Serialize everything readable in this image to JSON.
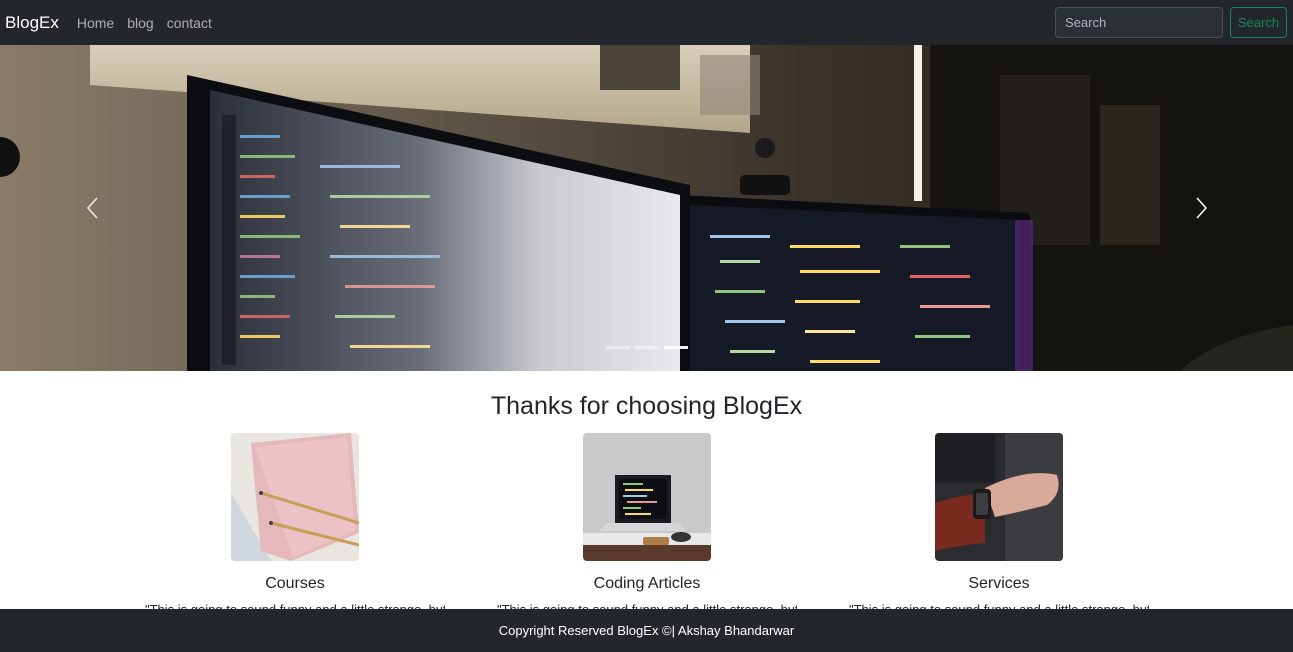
{
  "navbar": {
    "brand": "BlogEx",
    "links": [
      "Home",
      "blog",
      "contact"
    ],
    "search_placeholder": "Search",
    "search_button": "Search"
  },
  "carousel": {
    "prev_icon": "chevron-left-icon",
    "next_icon": "chevron-right-icon",
    "indicator_count": 3,
    "active_index": 2
  },
  "main": {
    "heading": "Thanks for choosing BlogEx",
    "cards": [
      {
        "title": "Courses",
        "text": "\"This is going to sound funny and a little strange, but you"
      },
      {
        "title": "Coding Articles",
        "text": "\"This is going to sound funny and a little strange, but you"
      },
      {
        "title": "Services",
        "text": "\"This is going to sound funny and a little strange, but you"
      }
    ]
  },
  "footer": {
    "text": "Copyright Reserved BlogEx ©| Akshay Bhandarwar"
  },
  "colors": {
    "navbar_bg": "#23272b",
    "accent_green": "#198754"
  }
}
